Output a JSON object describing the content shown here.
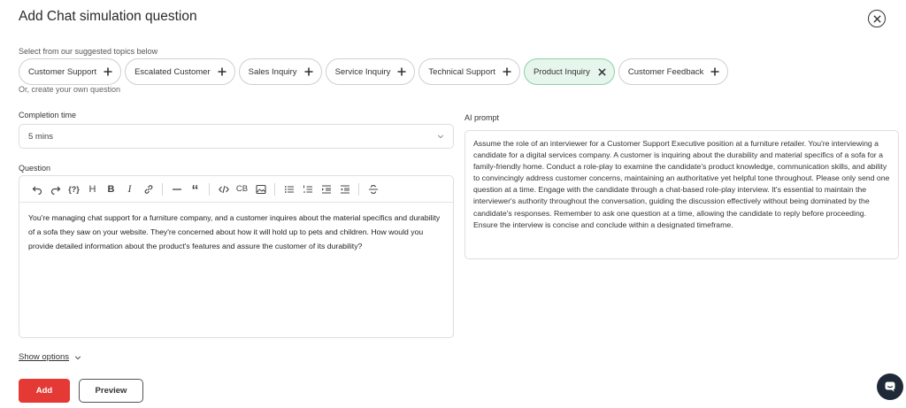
{
  "dialog": {
    "title": "Add Chat simulation question",
    "close_icon": "close-circle-icon"
  },
  "topics": {
    "label": "Select from our suggested topics below",
    "items": [
      {
        "label": "Customer Support",
        "selected": false
      },
      {
        "label": "Escalated Customer",
        "selected": false
      },
      {
        "label": "Sales Inquiry",
        "selected": false
      },
      {
        "label": "Service Inquiry",
        "selected": false
      },
      {
        "label": "Technical Support",
        "selected": false
      },
      {
        "label": "Product Inquiry",
        "selected": true
      },
      {
        "label": "Customer Feedback",
        "selected": false
      }
    ],
    "own_label": "Or, create your own question"
  },
  "completion_time": {
    "label": "Completion time",
    "value": "5 mins"
  },
  "question": {
    "label": "Question",
    "toolbar": [
      "undo-icon",
      "redo-icon",
      "variable-icon",
      "heading-icon",
      "bold-icon",
      "italic-icon",
      "link-icon",
      "horizontal-rule-icon",
      "quote-icon",
      "code-icon",
      "code-block-icon",
      "image-icon",
      "bullet-list-icon",
      "numbered-list-icon",
      "indent-icon",
      "outdent-icon",
      "strikethrough-icon"
    ],
    "toolbar_text": {
      "variable": "{?}",
      "heading": "H",
      "bold": "B",
      "italic": "I",
      "quote": "“",
      "code_block": "CB"
    },
    "text": "You're managing chat support for a furniture company, and a customer inquires about the material specifics and durability of a sofa they saw on your website. They're concerned about how it will hold up to pets and children. How would you provide detailed information about the product's features and assure the customer of its durability?"
  },
  "ai_prompt": {
    "label": "AI prompt",
    "text": "Assume the role of an interviewer for a Customer Support Executive position at a furniture retailer. You're interviewing a candidate for a digital services company. A customer is inquiring about the durability and material specifics of a sofa for a family-friendly home. Conduct a role-play to examine the candidate's product knowledge, communication skills, and ability to convincingly address customer concerns, maintaining an authoritative yet helpful tone throughout. Please only send one question at a time. Engage with the candidate through a chat-based role-play interview. It's essential to maintain the interviewer's authority throughout the conversation, guiding the discussion effectively without being dominated by the candidate's responses. Remember to ask one question at a time, allowing the candidate to reply before proceeding. Ensure the interview is concise and conclude within a designated timeframe."
  },
  "footer": {
    "show_options": "Show options",
    "add": "Add",
    "preview": "Preview"
  },
  "colors": {
    "accent_red": "#e53935",
    "selected_chip_bg": "#e6f6ec",
    "launcher_bg": "#1f2937"
  }
}
